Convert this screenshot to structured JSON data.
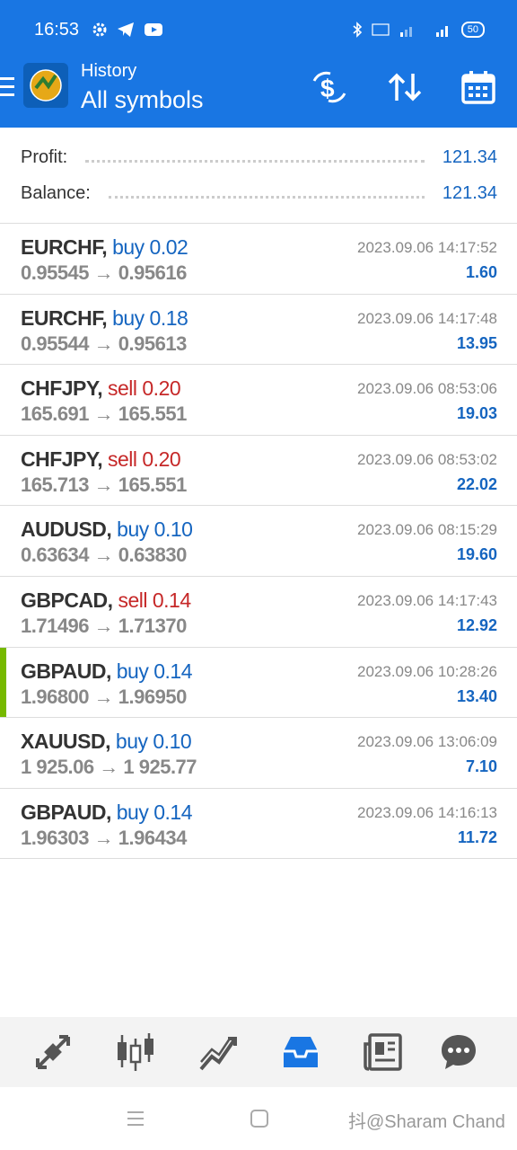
{
  "status_bar": {
    "time": "16:53",
    "battery": "50"
  },
  "header": {
    "subtitle": "History",
    "title": "All symbols"
  },
  "summary": {
    "profit_label": "Profit:",
    "profit_value": "121.34",
    "balance_label": "Balance:",
    "balance_value": "121.34"
  },
  "deals": [
    {
      "symbol": "EURCHF,",
      "side": "buy",
      "lots": "0.02",
      "open": "0.95545",
      "close": "0.95616",
      "time": "2023.09.06 14:17:52",
      "profit": "1.60"
    },
    {
      "symbol": "EURCHF,",
      "side": "buy",
      "lots": "0.18",
      "open": "0.95544",
      "close": "0.95613",
      "time": "2023.09.06 14:17:48",
      "profit": "13.95"
    },
    {
      "symbol": "CHFJPY,",
      "side": "sell",
      "lots": "0.20",
      "open": "165.691",
      "close": "165.551",
      "time": "2023.09.06 08:53:06",
      "profit": "19.03"
    },
    {
      "symbol": "CHFJPY,",
      "side": "sell",
      "lots": "0.20",
      "open": "165.713",
      "close": "165.551",
      "time": "2023.09.06 08:53:02",
      "profit": "22.02"
    },
    {
      "symbol": "AUDUSD,",
      "side": "buy",
      "lots": "0.10",
      "open": "0.63634",
      "close": "0.63830",
      "time": "2023.09.06 08:15:29",
      "profit": "19.60"
    },
    {
      "symbol": "GBPCAD,",
      "side": "sell",
      "lots": "0.14",
      "open": "1.71496",
      "close": "1.71370",
      "time": "2023.09.06 14:17:43",
      "profit": "12.92"
    },
    {
      "symbol": "GBPAUD,",
      "side": "buy",
      "lots": "0.14",
      "open": "1.96800",
      "close": "1.96950",
      "time": "2023.09.06 10:28:26",
      "profit": "13.40"
    },
    {
      "symbol": "XAUUSD,",
      "side": "buy",
      "lots": "0.10",
      "open": "1 925.06",
      "close": "1 925.77",
      "time": "2023.09.06 13:06:09",
      "profit": "7.10"
    },
    {
      "symbol": "GBPAUD,",
      "side": "buy",
      "lots": "0.14",
      "open": "1.96303",
      "close": "1.96434",
      "time": "2023.09.06 14:16:13",
      "profit": "11.72"
    }
  ],
  "bottom_nav": {
    "items": [
      "trade-icon",
      "chart-icon",
      "quotes-icon",
      "history-icon",
      "news-icon",
      "chat-icon"
    ],
    "active": "history-icon"
  },
  "watermark": "抖@Sharam Chand",
  "colors": {
    "accent": "#1976e3",
    "buy": "#1565c0",
    "sell": "#c62828",
    "selected_marker": "#76b900"
  }
}
